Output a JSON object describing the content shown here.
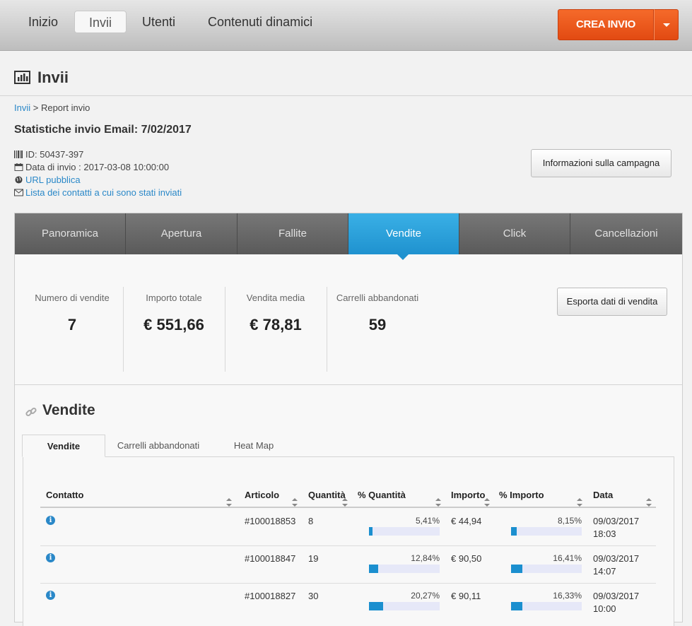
{
  "nav": {
    "items": [
      "Inizio",
      "Invii",
      "Utenti",
      "Contenuti dinamici"
    ],
    "active": "Invii",
    "create_label": "CREA INVIO"
  },
  "page": {
    "title": "Invii"
  },
  "breadcrumb": {
    "parent": "Invii",
    "separator": " > ",
    "current": "Report invio"
  },
  "campaign": {
    "title": "Statistiche invio Email: 7/02/2017",
    "id": "ID: 50437-397",
    "date": "Data di invio : 2017-03-08 10:00:00",
    "public_url": "URL pubblica",
    "contacts_link": "Lista dei contatti a cui sono stati inviati",
    "info_button": "Informazioni sulla campagna"
  },
  "tabs": [
    "Panoramica",
    "Apertura",
    "Fallite",
    "Vendite",
    "Click",
    "Cancellazioni"
  ],
  "active_tab": "Vendite",
  "kpis": [
    {
      "label": "Numero di vendite",
      "value": "7"
    },
    {
      "label": "Importo totale",
      "value": "€ 551,66"
    },
    {
      "label": "Vendita media",
      "value": "€ 78,81"
    },
    {
      "label": "Carrelli abbandonati",
      "value": "59"
    }
  ],
  "export_button": "Esporta dati di vendita",
  "section": {
    "title": "Vendite",
    "subtabs": [
      "Vendite",
      "Carrelli abbandonati",
      "Heat Map"
    ],
    "active_subtab": "Vendite"
  },
  "table": {
    "headers": [
      "Contatto",
      "Articolo",
      "Quantità",
      "% Quantità",
      "Importo",
      "% Importo",
      "Data"
    ],
    "rows": [
      {
        "articolo": "#100018853",
        "quantita": "8",
        "pct_quantita": "5,41%",
        "pct_quantita_value": 5.41,
        "importo": "€ 44,94",
        "pct_importo": "8,15%",
        "pct_importo_value": 8.15,
        "data": "09/03/2017",
        "ora": "18:03"
      },
      {
        "articolo": "#100018847",
        "quantita": "19",
        "pct_quantita": "12,84%",
        "pct_quantita_value": 12.84,
        "importo": "€ 90,50",
        "pct_importo": "16,41%",
        "pct_importo_value": 16.41,
        "data": "09/03/2017",
        "ora": "14:07"
      },
      {
        "articolo": "#100018827",
        "quantita": "30",
        "pct_quantita": "20,27%",
        "pct_quantita_value": 20.27,
        "importo": "€ 90,11",
        "pct_importo": "16,33%",
        "pct_importo_value": 16.33,
        "data": "09/03/2017",
        "ora": "10:00"
      }
    ]
  },
  "colors": {
    "accent": "#1f92cf",
    "create": "#e24a12",
    "link": "#2a88c8"
  }
}
